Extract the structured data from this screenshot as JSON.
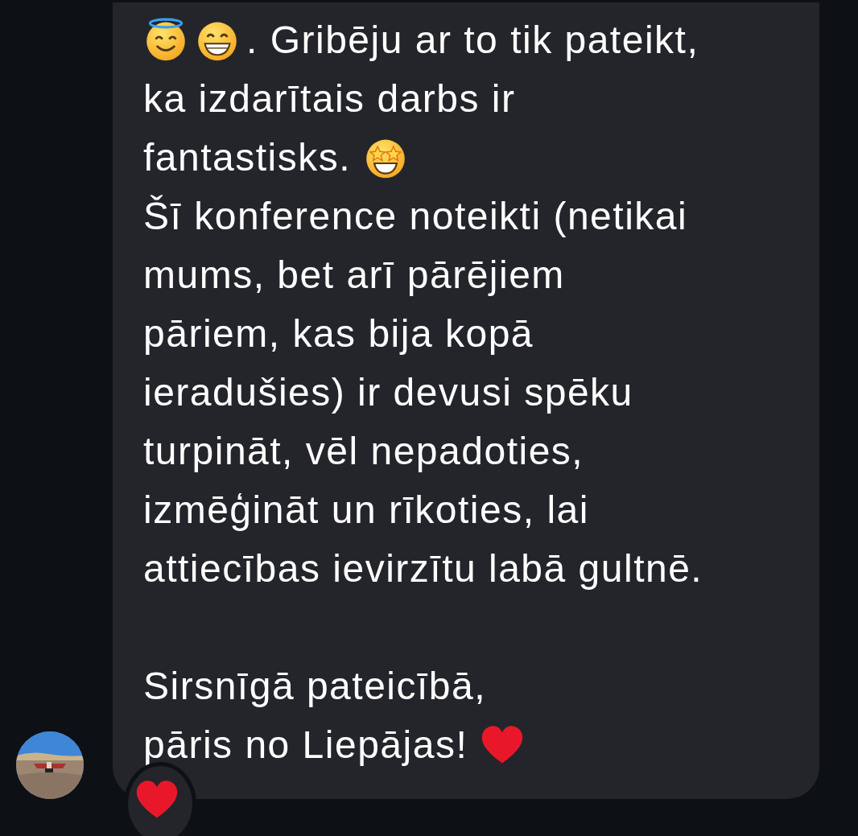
{
  "message": {
    "paragraphs": [
      {
        "lines": [
          [
            {
              "kind": "emoji-halo"
            },
            {
              "kind": "emoji-grin"
            },
            {
              "kind": "text",
              "text": ". Gribēju ar to tik pateikt,"
            }
          ],
          [
            {
              "kind": "text",
              "text": "ka izdarītais darbs ir"
            }
          ],
          [
            {
              "kind": "text",
              "text": "fantastisks. "
            },
            {
              "kind": "emoji-star-eyes"
            }
          ],
          [
            {
              "kind": "text",
              "text": "Šī konference noteikti (netikai"
            }
          ],
          [
            {
              "kind": "text",
              "text": "mums, bet arī pārējiem"
            }
          ],
          [
            {
              "kind": "text",
              "text": "pāriem, kas bija kopā"
            }
          ],
          [
            {
              "kind": "text",
              "text": "ieradušies) ir devusi spēku"
            }
          ],
          [
            {
              "kind": "text",
              "text": "turpināt, vēl nepadoties,"
            }
          ],
          [
            {
              "kind": "text",
              "text": "izmēģināt un rīkoties, lai"
            }
          ],
          [
            {
              "kind": "text",
              "text": "attiecības ievirzītu labā gultnē."
            }
          ]
        ]
      },
      {
        "lines": [
          [
            {
              "kind": "text",
              "text": "Sirsnīgā pateicībā,"
            }
          ],
          [
            {
              "kind": "text",
              "text": "pāris no Liepājas! "
            },
            {
              "kind": "emoji-heart"
            }
          ]
        ]
      }
    ]
  },
  "reactions": [
    {
      "kind": "emoji-heart"
    }
  ]
}
